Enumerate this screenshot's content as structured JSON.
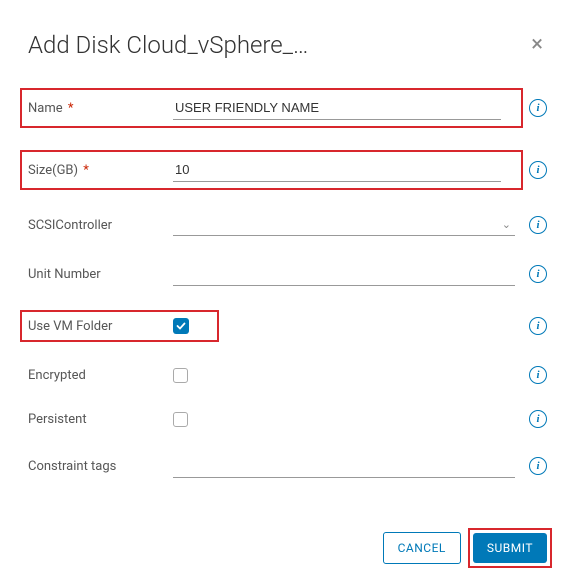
{
  "dialog": {
    "title": "Add Disk Cloud_vSphere_…"
  },
  "fields": {
    "name": {
      "label": "Name",
      "value": "USER FRIENDLY NAME"
    },
    "size": {
      "label": "Size(GB)",
      "value": "10"
    },
    "scsi": {
      "label": "SCSIController",
      "value": ""
    },
    "unit": {
      "label": "Unit Number",
      "value": ""
    },
    "vmfolder": {
      "label": "Use VM Folder",
      "checked": true
    },
    "encrypted": {
      "label": "Encrypted",
      "checked": false
    },
    "persistent": {
      "label": "Persistent",
      "checked": false
    },
    "constraint": {
      "label": "Constraint tags",
      "value": ""
    }
  },
  "buttons": {
    "cancel": "CANCEL",
    "submit": "SUBMIT"
  }
}
